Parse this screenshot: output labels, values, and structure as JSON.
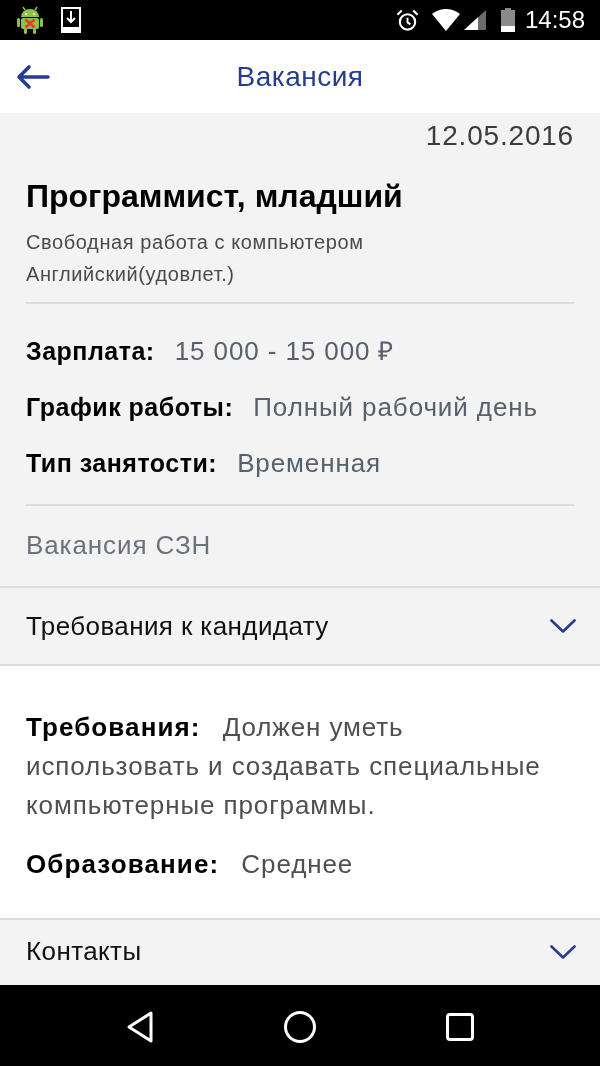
{
  "status_bar": {
    "time": "14:58"
  },
  "app_bar": {
    "title": "Вакансия"
  },
  "vacancy": {
    "date": "12.05.2016",
    "title": "Программист, младший",
    "skills": [
      "Свободная работа с компьютером",
      "Английский(удовлет.)"
    ],
    "details": [
      {
        "label": "Зарплата:",
        "value": "15 000 - 15 000 ₽"
      },
      {
        "label": "График работы:",
        "value": "Полный рабочий день"
      },
      {
        "label": "Тип занятости:",
        "value": "Временная"
      }
    ],
    "source": "Вакансия СЗН"
  },
  "sections": [
    {
      "title": "Требования к кандидату",
      "expanded": true,
      "fields": [
        {
          "label": "Требования:",
          "value": "Должен уметь использовать и создавать специальные компьютерные программы."
        },
        {
          "label": "Образование:",
          "value": "Среднее"
        }
      ]
    },
    {
      "title": "Контакты",
      "expanded": false
    }
  ]
}
